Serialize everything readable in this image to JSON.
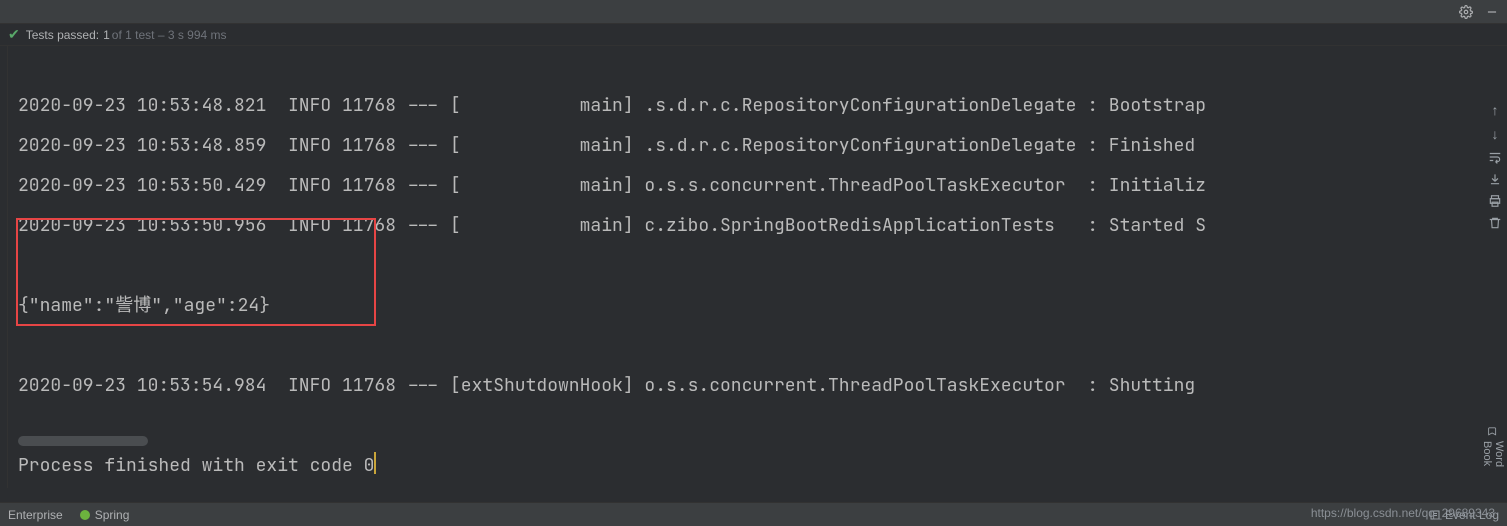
{
  "topbar": {
    "settings_icon": "gear-icon",
    "minimize_icon": "minimize-icon"
  },
  "tests": {
    "label": "Tests passed:",
    "count": "1",
    "suffix": "of 1 test – 3 s 994 ms"
  },
  "console": {
    "lines": [
      "2020-09-23 10:53:48.821  INFO 11768 --- [           main] .s.d.r.c.RepositoryConfigurationDelegate : Bootstrap",
      "2020-09-23 10:53:48.859  INFO 11768 --- [           main] .s.d.r.c.RepositoryConfigurationDelegate : Finished ",
      "2020-09-23 10:53:50.429  INFO 11768 --- [           main] o.s.s.concurrent.ThreadPoolTaskExecutor  : Initializ",
      "2020-09-23 10:53:50.956  INFO 11768 --- [           main] c.zibo.SpringBootRedisApplicationTests   : Started S",
      "",
      "{\"name\":\"訾博\",\"age\":24}",
      "",
      "2020-09-23 10:53:54.984  INFO 11768 --- [extShutdownHook] o.s.s.concurrent.ThreadPoolTaskExecutor  : Shutting ",
      "",
      "Process finished with exit code 0"
    ]
  },
  "right_tools": {
    "items": [
      "up-arrow-icon",
      "down-arrow-icon",
      "soft-wrap-icon",
      "scroll-to-end-icon",
      "print-icon",
      "clear-all-icon"
    ]
  },
  "wordbook": {
    "label": "Word Book"
  },
  "status": {
    "left": [
      "Enterprise",
      "Spring"
    ],
    "event_log": "Event Log"
  },
  "watermark": "https://blog.csdn.net/qq_29689343"
}
